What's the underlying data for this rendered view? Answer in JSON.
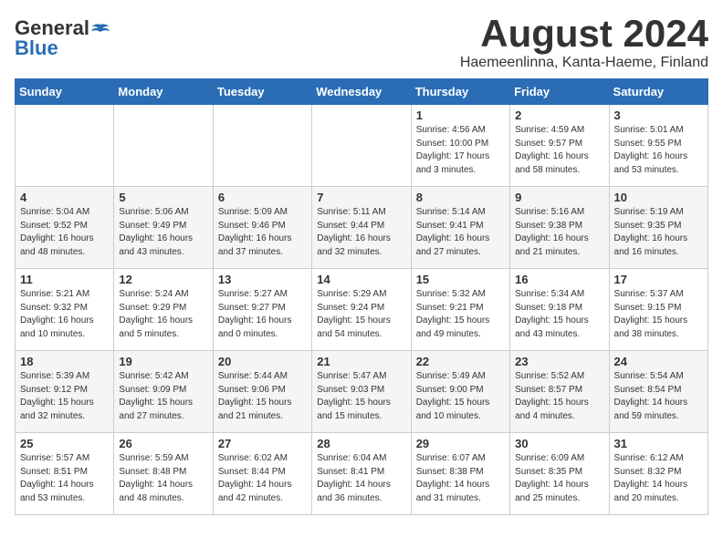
{
  "header": {
    "logo_general": "General",
    "logo_blue": "Blue",
    "month_year": "August 2024",
    "location": "Haemeenlinna, Kanta-Haeme, Finland"
  },
  "weekdays": [
    "Sunday",
    "Monday",
    "Tuesday",
    "Wednesday",
    "Thursday",
    "Friday",
    "Saturday"
  ],
  "weeks": [
    [
      {
        "day": "",
        "info": ""
      },
      {
        "day": "",
        "info": ""
      },
      {
        "day": "",
        "info": ""
      },
      {
        "day": "",
        "info": ""
      },
      {
        "day": "1",
        "info": "Sunrise: 4:56 AM\nSunset: 10:00 PM\nDaylight: 17 hours\nand 3 minutes."
      },
      {
        "day": "2",
        "info": "Sunrise: 4:59 AM\nSunset: 9:57 PM\nDaylight: 16 hours\nand 58 minutes."
      },
      {
        "day": "3",
        "info": "Sunrise: 5:01 AM\nSunset: 9:55 PM\nDaylight: 16 hours\nand 53 minutes."
      }
    ],
    [
      {
        "day": "4",
        "info": "Sunrise: 5:04 AM\nSunset: 9:52 PM\nDaylight: 16 hours\nand 48 minutes."
      },
      {
        "day": "5",
        "info": "Sunrise: 5:06 AM\nSunset: 9:49 PM\nDaylight: 16 hours\nand 43 minutes."
      },
      {
        "day": "6",
        "info": "Sunrise: 5:09 AM\nSunset: 9:46 PM\nDaylight: 16 hours\nand 37 minutes."
      },
      {
        "day": "7",
        "info": "Sunrise: 5:11 AM\nSunset: 9:44 PM\nDaylight: 16 hours\nand 32 minutes."
      },
      {
        "day": "8",
        "info": "Sunrise: 5:14 AM\nSunset: 9:41 PM\nDaylight: 16 hours\nand 27 minutes."
      },
      {
        "day": "9",
        "info": "Sunrise: 5:16 AM\nSunset: 9:38 PM\nDaylight: 16 hours\nand 21 minutes."
      },
      {
        "day": "10",
        "info": "Sunrise: 5:19 AM\nSunset: 9:35 PM\nDaylight: 16 hours\nand 16 minutes."
      }
    ],
    [
      {
        "day": "11",
        "info": "Sunrise: 5:21 AM\nSunset: 9:32 PM\nDaylight: 16 hours\nand 10 minutes."
      },
      {
        "day": "12",
        "info": "Sunrise: 5:24 AM\nSunset: 9:29 PM\nDaylight: 16 hours\nand 5 minutes."
      },
      {
        "day": "13",
        "info": "Sunrise: 5:27 AM\nSunset: 9:27 PM\nDaylight: 16 hours\nand 0 minutes."
      },
      {
        "day": "14",
        "info": "Sunrise: 5:29 AM\nSunset: 9:24 PM\nDaylight: 15 hours\nand 54 minutes."
      },
      {
        "day": "15",
        "info": "Sunrise: 5:32 AM\nSunset: 9:21 PM\nDaylight: 15 hours\nand 49 minutes."
      },
      {
        "day": "16",
        "info": "Sunrise: 5:34 AM\nSunset: 9:18 PM\nDaylight: 15 hours\nand 43 minutes."
      },
      {
        "day": "17",
        "info": "Sunrise: 5:37 AM\nSunset: 9:15 PM\nDaylight: 15 hours\nand 38 minutes."
      }
    ],
    [
      {
        "day": "18",
        "info": "Sunrise: 5:39 AM\nSunset: 9:12 PM\nDaylight: 15 hours\nand 32 minutes."
      },
      {
        "day": "19",
        "info": "Sunrise: 5:42 AM\nSunset: 9:09 PM\nDaylight: 15 hours\nand 27 minutes."
      },
      {
        "day": "20",
        "info": "Sunrise: 5:44 AM\nSunset: 9:06 PM\nDaylight: 15 hours\nand 21 minutes."
      },
      {
        "day": "21",
        "info": "Sunrise: 5:47 AM\nSunset: 9:03 PM\nDaylight: 15 hours\nand 15 minutes."
      },
      {
        "day": "22",
        "info": "Sunrise: 5:49 AM\nSunset: 9:00 PM\nDaylight: 15 hours\nand 10 minutes."
      },
      {
        "day": "23",
        "info": "Sunrise: 5:52 AM\nSunset: 8:57 PM\nDaylight: 15 hours\nand 4 minutes."
      },
      {
        "day": "24",
        "info": "Sunrise: 5:54 AM\nSunset: 8:54 PM\nDaylight: 14 hours\nand 59 minutes."
      }
    ],
    [
      {
        "day": "25",
        "info": "Sunrise: 5:57 AM\nSunset: 8:51 PM\nDaylight: 14 hours\nand 53 minutes."
      },
      {
        "day": "26",
        "info": "Sunrise: 5:59 AM\nSunset: 8:48 PM\nDaylight: 14 hours\nand 48 minutes."
      },
      {
        "day": "27",
        "info": "Sunrise: 6:02 AM\nSunset: 8:44 PM\nDaylight: 14 hours\nand 42 minutes."
      },
      {
        "day": "28",
        "info": "Sunrise: 6:04 AM\nSunset: 8:41 PM\nDaylight: 14 hours\nand 36 minutes."
      },
      {
        "day": "29",
        "info": "Sunrise: 6:07 AM\nSunset: 8:38 PM\nDaylight: 14 hours\nand 31 minutes."
      },
      {
        "day": "30",
        "info": "Sunrise: 6:09 AM\nSunset: 8:35 PM\nDaylight: 14 hours\nand 25 minutes."
      },
      {
        "day": "31",
        "info": "Sunrise: 6:12 AM\nSunset: 8:32 PM\nDaylight: 14 hours\nand 20 minutes."
      }
    ]
  ]
}
